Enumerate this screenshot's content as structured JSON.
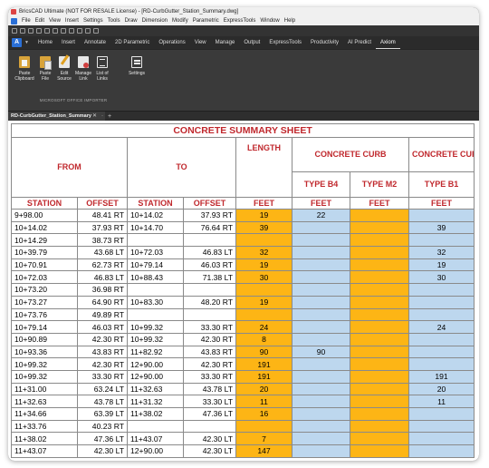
{
  "window": {
    "title": "BricsCAD Ultimate (NOT FOR RESALE License) - [RD-CurbGutter_Station_Summary.dwg]"
  },
  "menu": [
    "File",
    "Edit",
    "View",
    "Insert",
    "Settings",
    "Tools",
    "Draw",
    "Dimension",
    "Modify",
    "Parametric",
    "ExpressTools",
    "Window",
    "Help"
  ],
  "ribbon_tabs": [
    "Home",
    "Insert",
    "Annotate",
    "2D Parametric",
    "Operations",
    "View",
    "Manage",
    "Output",
    "ExpressTools",
    "Productivity",
    "AI Predict",
    "Axiom"
  ],
  "ribbon_active_tab": "Axiom",
  "ribbon_buttons": [
    {
      "line1": "Paste",
      "line2": "Clipboard",
      "icon": "paste-clipboard-icon"
    },
    {
      "line1": "Paste",
      "line2": "File",
      "icon": "paste-file-icon"
    },
    {
      "line1": "Edit",
      "line2": "Source",
      "icon": "edit-source-icon"
    },
    {
      "line1": "Manage",
      "line2": "Link",
      "icon": "manage-link-icon"
    },
    {
      "line1": "List of",
      "line2": "Links",
      "icon": "list-of-links-icon"
    },
    {
      "line1": "Settings",
      "line2": "",
      "icon": "settings-icon"
    }
  ],
  "ribbon_group_label": "MICROSOFT OFFICE IMPORTER",
  "document_tab": {
    "label": "RD-CurbGutter_Station_Summary",
    "close": "✕",
    "new": "+"
  },
  "sheet": {
    "title": "CONCRETE SUMMARY SHEET",
    "headers": {
      "from": "FROM",
      "to": "TO",
      "length": "LENGTH",
      "concrete_curb": "CONCRETE CURB",
      "curb_gutter": "CONCRETE CURB & GUTTER",
      "type_b4": "TYPE B4",
      "type_m2": "TYPE M2",
      "type_b1": "TYPE B1"
    },
    "columns": [
      "STATION",
      "OFFSET",
      "STATION",
      "OFFSET",
      "FEET",
      "FEET",
      "FEET",
      "FEET"
    ],
    "rows": [
      [
        "9+98.00",
        "48.41 RT",
        "10+14.02",
        "37.93 RT",
        "19",
        "22",
        "",
        ""
      ],
      [
        "10+14.02",
        "37.93 RT",
        "10+14.70",
        "76.64 RT",
        "39",
        "",
        "",
        "39"
      ],
      [
        "10+14.29",
        "38.73 RT",
        "",
        "",
        "",
        "",
        "",
        ""
      ],
      [
        "10+39.79",
        "43.68 LT",
        "10+72.03",
        "46.83 LT",
        "32",
        "",
        "",
        "32"
      ],
      [
        "10+70.91",
        "62.73 RT",
        "10+79.14",
        "46.03 RT",
        "19",
        "",
        "",
        "19"
      ],
      [
        "10+72.03",
        "46.83 LT",
        "10+88.43",
        "71.38 LT",
        "30",
        "",
        "",
        "30"
      ],
      [
        "10+73.20",
        "36.98 RT",
        "",
        "",
        "",
        "",
        "",
        ""
      ],
      [
        "10+73.27",
        "64.90 RT",
        "10+83.30",
        "48.20 RT",
        "19",
        "",
        "",
        ""
      ],
      [
        "10+73.76",
        "49.89 RT",
        "",
        "",
        "",
        "",
        "",
        ""
      ],
      [
        "10+79.14",
        "46.03 RT",
        "10+99.32",
        "33.30 RT",
        "24",
        "",
        "",
        "24"
      ],
      [
        "10+90.89",
        "42.30 RT",
        "10+99.32",
        "42.30 RT",
        "8",
        "",
        "",
        ""
      ],
      [
        "10+93.36",
        "43.83 RT",
        "11+82.92",
        "43.83 RT",
        "90",
        "90",
        "",
        ""
      ],
      [
        "10+99.32",
        "42.30 RT",
        "12+90.00",
        "42.30 RT",
        "191",
        "",
        "",
        ""
      ],
      [
        "10+99.32",
        "33.30 RT",
        "12+90.00",
        "33.30 RT",
        "191",
        "",
        "",
        "191"
      ],
      [
        "11+31.00",
        "63.24 LT",
        "11+32.63",
        "43.78 LT",
        "20",
        "",
        "",
        "20"
      ],
      [
        "11+32.63",
        "43.78 LT",
        "11+31.32",
        "33.30 LT",
        "11",
        "",
        "",
        "11"
      ],
      [
        "11+34.66",
        "63.39 LT",
        "11+38.02",
        "47.36 LT",
        "16",
        "",
        "",
        ""
      ],
      [
        "11+33.76",
        "40.23 RT",
        "",
        "",
        "",
        "",
        "",
        ""
      ],
      [
        "11+38.02",
        "47.36 LT",
        "11+43.07",
        "42.30 LT",
        "7",
        "",
        "",
        ""
      ],
      [
        "11+43.07",
        "42.30 LT",
        "12+90.00",
        "42.30 LT",
        "147",
        "",
        "",
        ""
      ]
    ]
  },
  "colors": {
    "header_red": "#c0282d",
    "length_orange": "#fdb515",
    "type_blue": "#bdd7ee",
    "app_accent": "#2a6fd6"
  }
}
